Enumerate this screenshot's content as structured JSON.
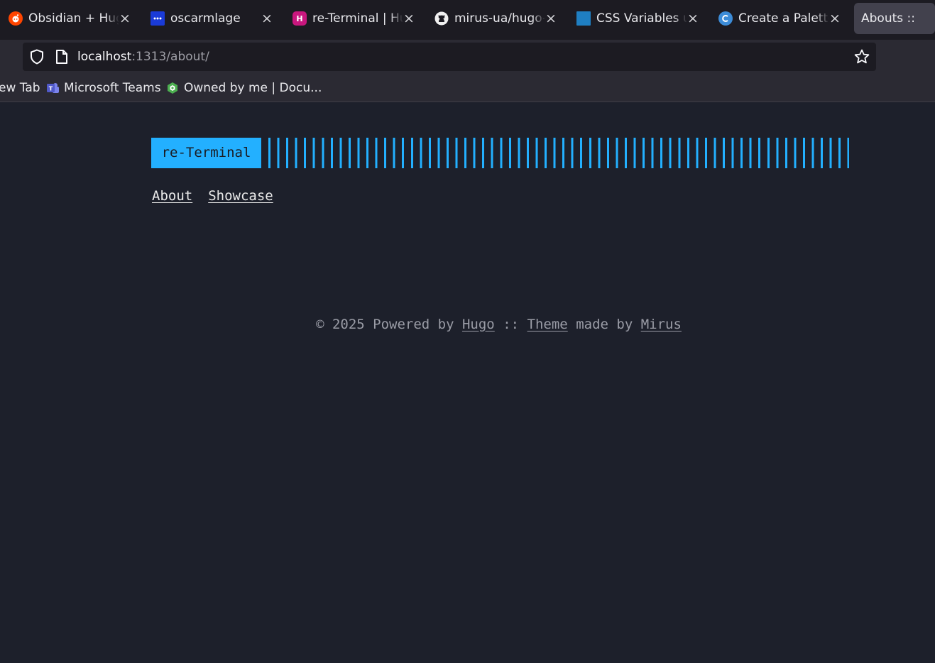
{
  "browser": {
    "tabs": [
      {
        "title": "Obsidian + Hugo",
        "icon": "reddit-icon",
        "active": false
      },
      {
        "title": "oscarmlage",
        "icon": "oscarmlage-favicon-icon",
        "active": false
      },
      {
        "title": "re-Terminal | Hugo",
        "icon": "hugo-icon",
        "active": false
      },
      {
        "title": "mirus-ua/hugo-theme",
        "icon": "github-icon",
        "active": false
      },
      {
        "title": "CSS Variables update",
        "icon": "css-favicon-icon",
        "active": false
      },
      {
        "title": "Create a Palette",
        "icon": "palette-site-icon",
        "active": false
      },
      {
        "title": "Abouts ::",
        "icon": "",
        "active": true
      }
    ],
    "url_host": "localhost",
    "url_rest": ":1313/about/",
    "bookmarks": [
      {
        "label": "ew Tab",
        "icon": ""
      },
      {
        "label": "Microsoft Teams",
        "icon": "teams-icon"
      },
      {
        "label": "Owned by me | Docu...",
        "icon": "owned-doc-icon"
      }
    ],
    "colors": {
      "tabstrip": "#1c1b22",
      "toolbar": "#2b2a33",
      "active_tab": "#42414d"
    }
  },
  "site": {
    "logo": "re-Terminal",
    "menu": [
      "About",
      "Showcase"
    ],
    "footer": {
      "prefix": "© 2025 Powered by",
      "hugo": "Hugo",
      "sep": "::",
      "theme": "Theme",
      "made_by": "made by",
      "author": "Mirus"
    },
    "colors": {
      "background": "#1d202b",
      "accent": "#23b0ff"
    }
  }
}
